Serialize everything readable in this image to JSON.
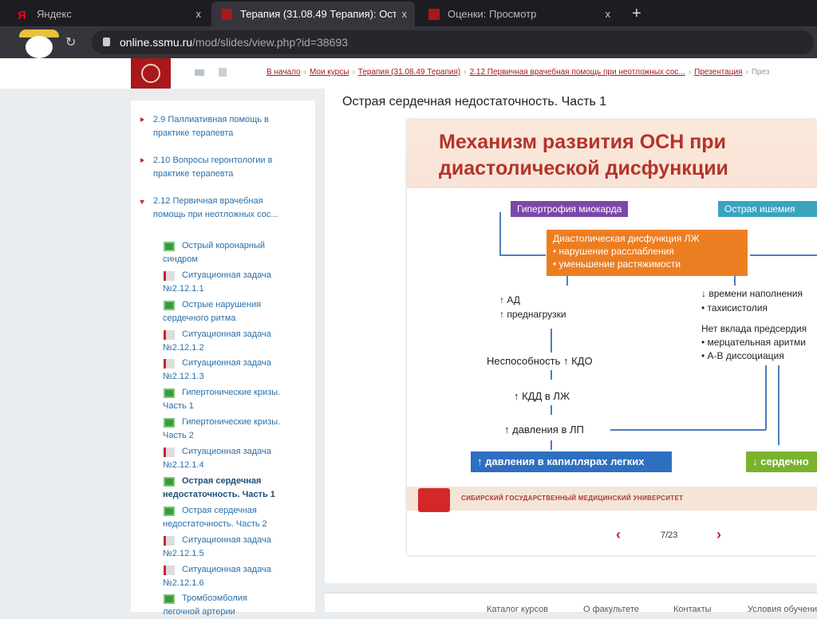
{
  "browser": {
    "tabs": [
      {
        "label": "Яндекс",
        "active": false
      },
      {
        "label": "Терапия (31.08.49 Терапия): Ост",
        "active": true
      },
      {
        "label": "Оценки: Просмотр",
        "active": false
      }
    ],
    "close": "x",
    "new_tab": "+",
    "url_domain": "online.ssmu.ru",
    "url_path": "/mod/slides/view.php?id=38693"
  },
  "breadcrumbs": [
    "В начало",
    "Мои курсы",
    "Терапия (31.08.49 Терапия)",
    "2.12 Первичная врачебная помощь при неотложных сос...",
    "Презентация",
    "През"
  ],
  "sidebar": {
    "chapters": [
      "2.9 Паллиативная помощь в практике терапевта",
      "2.10 Вопросы геронтологии в практике терапевта",
      "2.12 Первичная врачебная помощь при неотложных сос..."
    ],
    "items": [
      {
        "label": "Острый коронарный синдром",
        "type": "presentation"
      },
      {
        "label": "Ситуационная задача №2.12.1.1",
        "type": "task"
      },
      {
        "label": "Острые нарушения сердечного ритма",
        "type": "presentation"
      },
      {
        "label": "Ситуационная задача №2.12.1.2",
        "type": "task"
      },
      {
        "label": "Ситуационная задача №2.12.1.3",
        "type": "task"
      },
      {
        "label": "Гипертонические кризы. Часть 1",
        "type": "presentation"
      },
      {
        "label": "Гипертонические кризы. Часть 2",
        "type": "presentation"
      },
      {
        "label": "Ситуационная задача №2.12.1.4",
        "type": "task"
      },
      {
        "label": "Острая сердечная недостаточность. Часть 1",
        "type": "presentation",
        "current": true
      },
      {
        "label": "Острая сердечная недостаточность. Часть 2",
        "type": "presentation"
      },
      {
        "label": "Ситуационная задача №2.12.1.5",
        "type": "task"
      },
      {
        "label": "Ситуационная задача №2.12.1.6",
        "type": "task"
      },
      {
        "label": "Тромбоэмболия легочной артерии",
        "type": "presentation"
      }
    ]
  },
  "main": {
    "title": "Острая сердечная недостаточность. Часть 1"
  },
  "slide": {
    "title": "Механизм развития ОСН при диастолической дисфункции",
    "hypertrophy": "Гипертрофия миокарда",
    "ischemia": "Острая ишемия",
    "dysf_title": "Диастолическая дисфункция ЛЖ",
    "dysf_1": "• нарушение расслабления",
    "dysf_2": "• уменьшение растяжимости",
    "ad": "↑ АД",
    "preload": "↑ преднагрузки",
    "kdo": "Неспособность ↑ КДО",
    "kdd": "↑ КДД в ЛЖ",
    "lp": "↑ давления в ЛП",
    "capill": "↑ давления в капиллярах легких",
    "cardiac": "↓ сердечно",
    "fill": "↓ времени наполнения",
    "tachy": "• тахисистолия",
    "atrial": "Нет вклада предсердия",
    "af": "• мерцательная аритми",
    "av": "• А-В диссоциация",
    "footer": "СИБИРСКИЙ ГОСУДАРСТВЕННЫЙ МЕДИЦИНСКИЙ УНИВЕРСИТЕТ",
    "page": "7/23",
    "prev": "‹",
    "next": "›"
  },
  "footer": [
    "Каталог курсов",
    "О факультете",
    "Контакты",
    "Условия обучени"
  ]
}
